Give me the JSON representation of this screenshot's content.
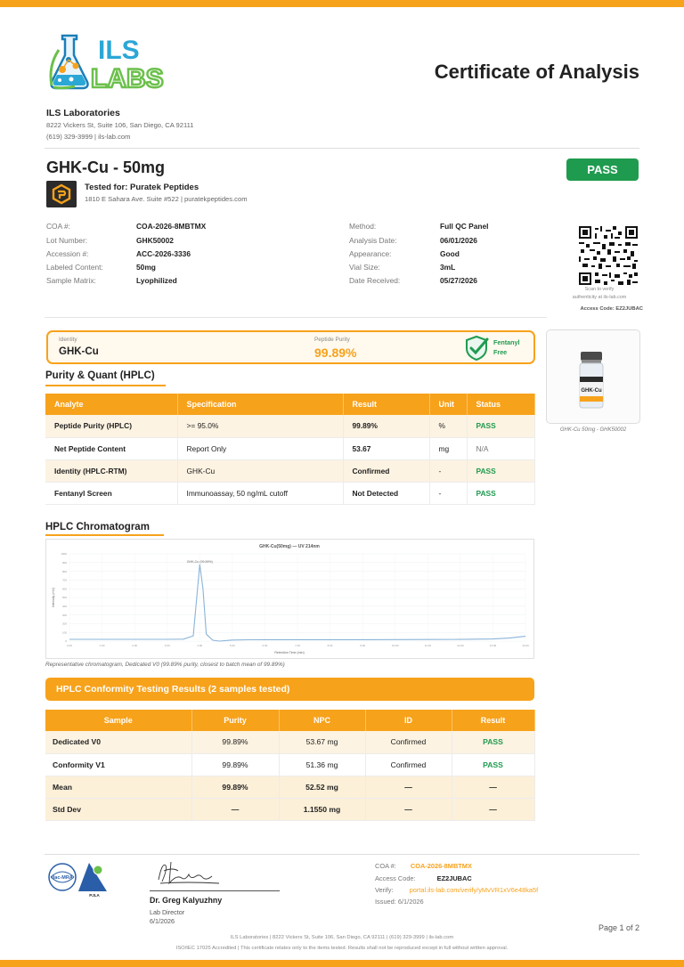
{
  "header": {
    "logo_text_top": "ILS",
    "logo_text_bottom": "LABS",
    "doc_title": "Certificate of Analysis",
    "lab_name": "ILS Laboratories",
    "lab_address": "8222 Vickers St, Suite 106, San Diego, CA 92111",
    "lab_contact": "(619) 329-3999  |  ils-lab.com"
  },
  "product": {
    "name": "GHK-Cu - 50mg",
    "status": "PASS",
    "tested_for": "Tested for: Puratek Peptides",
    "client_address": "1810 E Sahara Ave. Suite #522  |  puratekpeptides.com"
  },
  "meta_left": [
    {
      "key": "COA #:",
      "value": "COA-2026-8MBTMX"
    },
    {
      "key": "Lot Number:",
      "value": "GHK50002"
    },
    {
      "key": "Accession #:",
      "value": "ACC-2026-3336"
    },
    {
      "key": "Labeled Content:",
      "value": "50mg"
    },
    {
      "key": "Sample Matrix:",
      "value": "Lyophilized"
    }
  ],
  "meta_right": [
    {
      "key": "Method:",
      "value": "Full QC Panel"
    },
    {
      "key": "Analysis Date:",
      "value": "06/01/2026"
    },
    {
      "key": "Appearance:",
      "value": "Good"
    },
    {
      "key": "Vial Size:",
      "value": "3mL"
    },
    {
      "key": "Date Received:",
      "value": "05/27/2026"
    }
  ],
  "qr": {
    "caption1": "Scan to verify",
    "caption2": "authenticity at ils-lab.com",
    "access_code": "Access Code: EZ2JUBAC"
  },
  "summary": {
    "identity_label": "Identity",
    "identity_value": "GHK-Cu",
    "purity_label": "Peptide Purity",
    "purity_value": "99.89%",
    "fentanyl_line1": "Fentanyl",
    "fentanyl_line2": "Free"
  },
  "vial": {
    "label": "GHK-Cu",
    "caption": "GHK-Cu 50mg - GHK50002"
  },
  "purity_section": {
    "title": "Purity & Quant (HPLC)",
    "headers": [
      "Analyte",
      "Specification",
      "Result",
      "Unit",
      "Status"
    ],
    "rows": [
      [
        "Peptide Purity (HPLC)",
        ">= 95.0%",
        "99.89%",
        "%",
        "PASS"
      ],
      [
        "Net Peptide Content",
        "Report Only",
        "53.67",
        "mg",
        "N/A"
      ],
      [
        "Identity (HPLC-RTM)",
        "GHK-Cu",
        "Confirmed",
        "-",
        "PASS"
      ],
      [
        "Fentanyl Screen",
        "Immunoassay, 50 ng/mL cutoff",
        "Not Detected",
        "-",
        "PASS"
      ]
    ]
  },
  "chromatogram": {
    "title": "HPLC Chromatogram",
    "caption": "Representative chromatogram, Dedicated V0 (99.89% purity, closest to batch mean of 99.89%)"
  },
  "chart_data": {
    "type": "line",
    "title": "GHK-Cu(50mg) — UV 214nm",
    "xlabel": "Retention Time (min)",
    "ylabel": "Intensity (mV)",
    "peak_label": "GHK-Cu (99.89%)",
    "x": [
      0.0,
      1.0,
      2.0,
      3.0,
      3.5,
      3.8,
      4.0,
      4.1,
      4.2,
      4.4,
      4.6,
      5.0,
      5.5,
      6.0,
      7.0,
      8.0,
      9.0,
      10.0,
      11.0,
      12.0,
      13.0,
      13.5,
      14.0
    ],
    "y": [
      20,
      20,
      20,
      20,
      22,
      60,
      880,
      600,
      80,
      10,
      0,
      12,
      15,
      16,
      16,
      16,
      16,
      17,
      18,
      19,
      24,
      35,
      55
    ],
    "ylim": [
      0,
      1000
    ],
    "xlim": [
      0,
      14
    ],
    "grid": true
  },
  "conformity": {
    "title": "HPLC Conformity Testing Results (2 samples tested)",
    "headers": [
      "Sample",
      "Purity",
      "NPC",
      "ID",
      "Result"
    ],
    "rows": [
      [
        "Dedicated V0",
        "99.89%",
        "53.67 mg",
        "Confirmed",
        "PASS"
      ],
      [
        "Conformity V1",
        "99.89%",
        "51.36 mg",
        "Confirmed",
        "PASS"
      ]
    ],
    "summary_rows": [
      [
        "Mean",
        "99.89%",
        "52.52 mg",
        "—",
        "—"
      ],
      [
        "Std Dev",
        "—",
        "1.1550 mg",
        "—",
        "—"
      ]
    ]
  },
  "footer": {
    "accred_text1": "ilac-MRA",
    "accred_text2": "PJLA",
    "signer_name": "Dr. Greg Kalyuzhny",
    "signer_role": "Lab Director",
    "signer_date": "6/1/2026",
    "coa_label": "COA #:",
    "coa_value": "COA-2026-8MBTMX",
    "access_label": "Access Code:",
    "access_value": "EZ2JUBAC",
    "verify_label": "Verify:",
    "verify_url": "portal.ils-lab.com/verify/yMvVR1xV6e48ka5f",
    "issued": "Issued: 6/1/2026",
    "page": "Page 1 of 2",
    "line1": "ILS Laboratories  |  8222 Vickers St, Suite 106, San Diego, CA 92111  |  (619) 329-3999  |  ils-lab.com",
    "line2": "ISO/IEC 17025 Accredited  |  This certificate relates only to the items tested. Results shall not be reproduced except in full without written approval."
  },
  "colors": {
    "accent": "#f7a21b",
    "pass": "#1f9b4f"
  }
}
